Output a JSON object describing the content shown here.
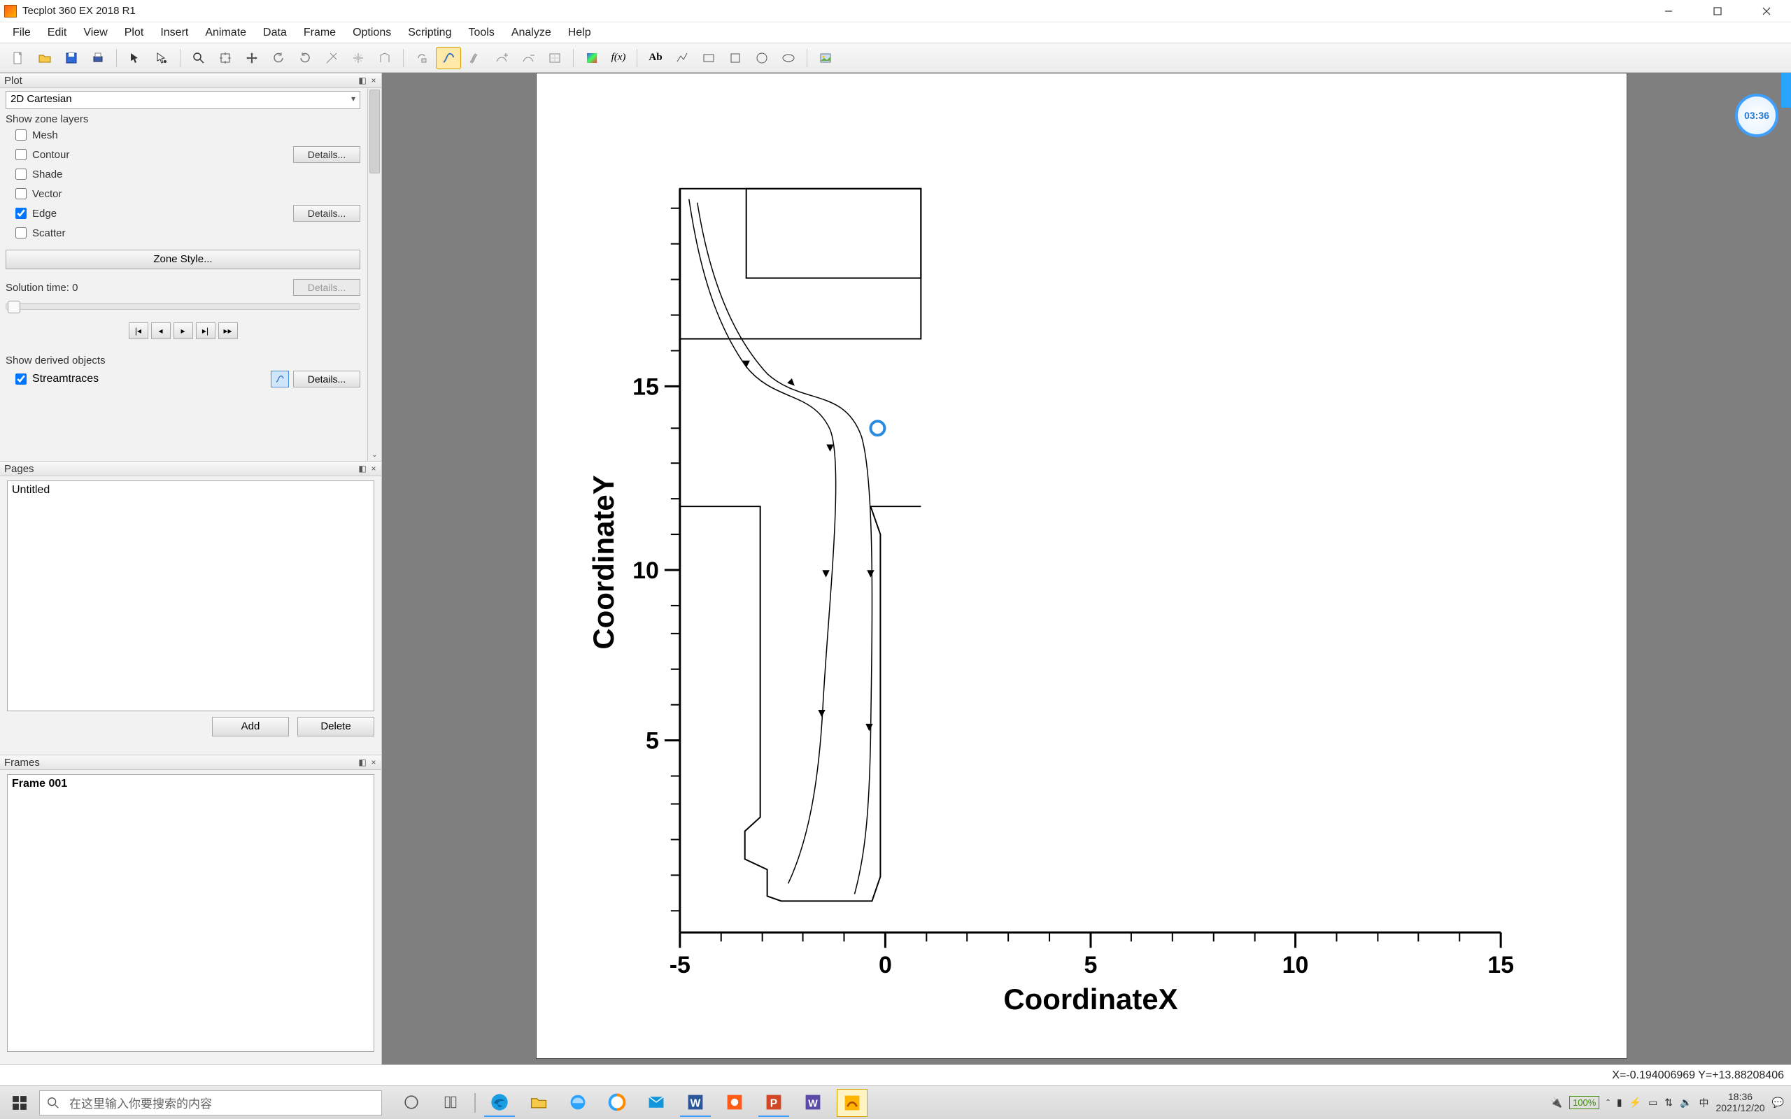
{
  "window": {
    "title": "Tecplot 360 EX 2018 R1"
  },
  "menu": [
    "File",
    "Edit",
    "View",
    "Plot",
    "Insert",
    "Animate",
    "Data",
    "Frame",
    "Options",
    "Scripting",
    "Tools",
    "Analyze",
    "Help"
  ],
  "sidebar": {
    "plot_panel_title": "Plot",
    "plot_type": "2D Cartesian",
    "show_zone_layers_label": "Show zone layers",
    "layers": {
      "mesh": "Mesh",
      "contour": "Contour",
      "shade": "Shade",
      "vector": "Vector",
      "edge": "Edge",
      "scatter": "Scatter"
    },
    "details_label": "Details...",
    "zone_style_label": "Zone Style...",
    "solution_time_label": "Solution time:",
    "solution_time_value": "0",
    "show_derived_label": "Show derived objects",
    "streamtraces_label": "Streamtraces",
    "pages_panel_title": "Pages",
    "pages": [
      "Untitled"
    ],
    "add_label": "Add",
    "delete_label": "Delete",
    "frames_panel_title": "Frames",
    "frames": [
      "Frame 001"
    ]
  },
  "chart_data": {
    "type": "line",
    "title": "",
    "xlabel": "CoordinateX",
    "ylabel": "CoordinateY",
    "xlim": [
      -5,
      15
    ],
    "ylim": [
      1,
      18
    ],
    "x_ticks_major": [
      -5,
      0,
      5,
      10,
      15
    ],
    "y_ticks_major": [
      5,
      10,
      15
    ],
    "annotation_marker": {
      "x": -0.19,
      "y": 13.88,
      "shape": "open-circle",
      "color": "#2a8ae0"
    },
    "geometry_outline": "streamtrace edge outline of a vertical nozzle/actuator body with chamber at top, approximate polyline in data coords",
    "series": [
      {
        "name": "outer-boundary",
        "type": "polyline",
        "points": [
          [
            -5,
            18
          ],
          [
            0.8,
            18
          ],
          [
            0.8,
            16.4
          ],
          [
            -5,
            16.4
          ]
        ]
      },
      {
        "name": "chamber-box",
        "type": "polyline",
        "points": [
          [
            -3.9,
            18
          ],
          [
            0.8,
            18
          ],
          [
            0.8,
            12.4
          ],
          [
            -0.4,
            12.4
          ],
          [
            -0.4,
            16.4
          ],
          [
            -3.9,
            16.4
          ],
          [
            -3.9,
            18
          ]
        ]
      },
      {
        "name": "body-left",
        "type": "polyline",
        "points": [
          [
            -4.2,
            12.4
          ],
          [
            -3.0,
            12.4
          ],
          [
            -3.0,
            3.4
          ],
          [
            -3.4,
            3.1
          ],
          [
            -3.4,
            2.5
          ],
          [
            -2.9,
            2.3
          ],
          [
            -2.9,
            1.6
          ]
        ]
      },
      {
        "name": "stream-a",
        "type": "polyline-with-arrows",
        "points": [
          [
            -4.6,
            17.8
          ],
          [
            -4.3,
            16.6
          ],
          [
            -3.8,
            15.6
          ],
          [
            -3.2,
            15.0
          ],
          [
            -2.4,
            14.8
          ],
          [
            -1.8,
            14.6
          ],
          [
            -1.4,
            13.6
          ],
          [
            -1.4,
            11.0
          ],
          [
            -1.5,
            8.0
          ],
          [
            -1.7,
            5.0
          ],
          [
            -2.0,
            3.0
          ],
          [
            -2.4,
            2.0
          ]
        ]
      },
      {
        "name": "stream-b",
        "type": "polyline-with-arrows",
        "points": [
          [
            -4.5,
            17.6
          ],
          [
            -4.0,
            16.2
          ],
          [
            -3.2,
            15.2
          ],
          [
            -2.2,
            15.0
          ],
          [
            -1.2,
            14.9
          ],
          [
            -0.8,
            14.2
          ],
          [
            -0.7,
            12.0
          ],
          [
            -0.7,
            9.0
          ],
          [
            -0.7,
            6.0
          ],
          [
            -0.8,
            3.5
          ],
          [
            -1.0,
            2.0
          ]
        ]
      }
    ]
  },
  "timer": "03:36",
  "status": {
    "coord_readout": "X=-0.194006969  Y=+13.88208406"
  },
  "taskbar": {
    "search_placeholder": "在这里输入你要搜索的内容",
    "battery": "100%",
    "ime": "中",
    "time": "18:36",
    "date": "2021/12/20"
  }
}
